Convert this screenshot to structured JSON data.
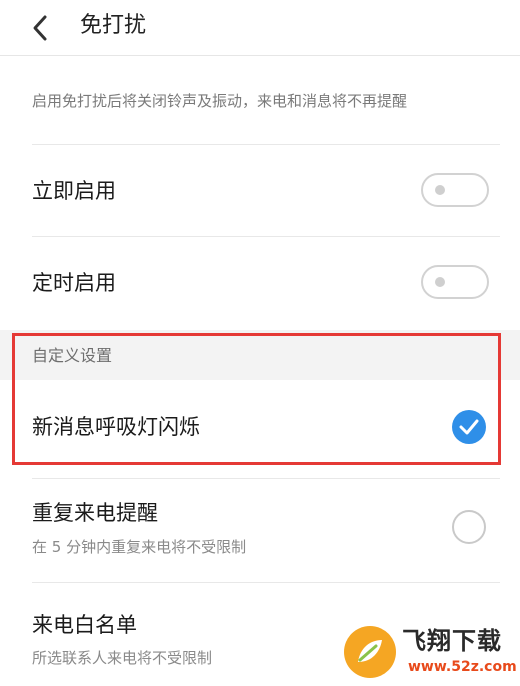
{
  "header": {
    "title": "免打扰",
    "back_icon": "back-arrow-icon"
  },
  "description": "启用免打扰后将关闭铃声及振动，来电和消息将不再提醒",
  "rows": {
    "enable_now": {
      "label": "立即启用",
      "toggle_on": false
    },
    "scheduled": {
      "label": "定时启用",
      "toggle_on": false
    }
  },
  "custom_section": {
    "title": "自定义设置",
    "breathing_light": {
      "label": "新消息呼吸灯闪烁",
      "checked": true
    },
    "repeat_call": {
      "label": "重复来电提醒",
      "sub": "在 5 分钟内重复来电将不受限制",
      "checked": false
    },
    "whitelist": {
      "label": "来电白名单",
      "sub": "所选联系人来电将不受限制"
    }
  },
  "watermark": {
    "brand": "飞翔下载",
    "url": "www.52z.com"
  },
  "colors": {
    "accent": "#2f8fe8",
    "highlight_border": "#e53935",
    "section_bg": "#f3f3f3"
  }
}
